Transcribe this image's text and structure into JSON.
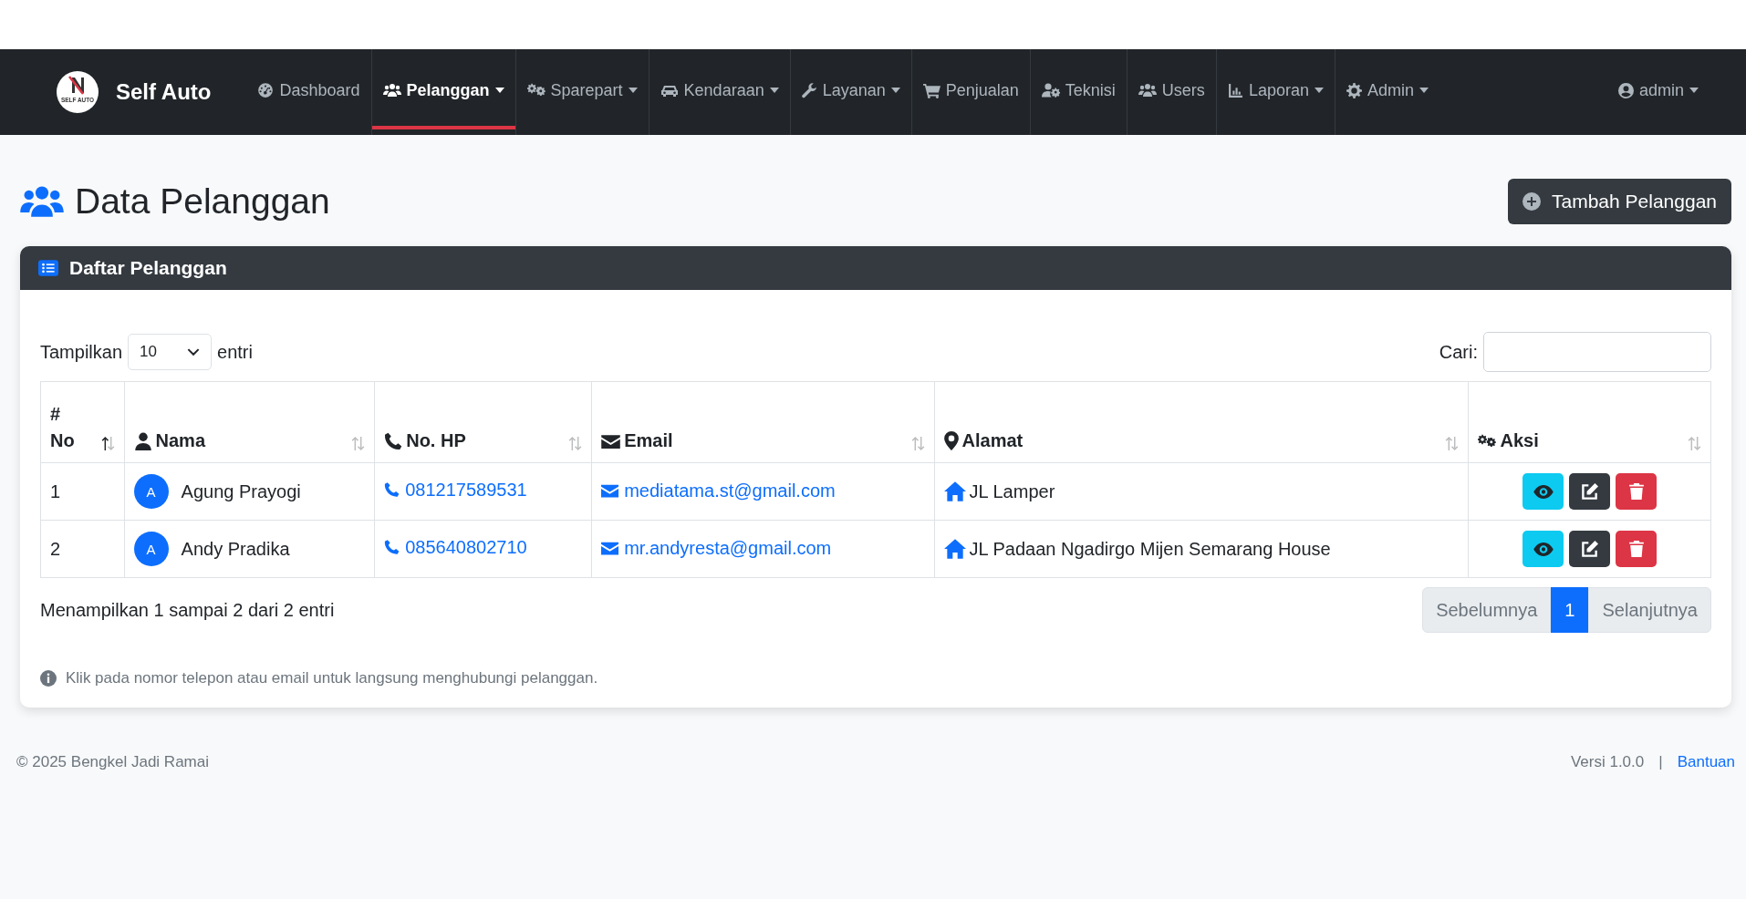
{
  "brand": {
    "name": "Self Auto",
    "logo_text": "SELF AUTO"
  },
  "nav": [
    {
      "label": "Dashboard",
      "dropdown": false,
      "selected": false
    },
    {
      "label": "Pelanggan",
      "dropdown": true,
      "selected": true
    },
    {
      "label": "Sparepart",
      "dropdown": true,
      "selected": false
    },
    {
      "label": "Kendaraan",
      "dropdown": true,
      "selected": false
    },
    {
      "label": "Layanan",
      "dropdown": true,
      "selected": false
    },
    {
      "label": "Penjualan",
      "dropdown": false,
      "selected": false
    },
    {
      "label": "Teknisi",
      "dropdown": false,
      "selected": false
    },
    {
      "label": "Users",
      "dropdown": false,
      "selected": false
    },
    {
      "label": "Laporan",
      "dropdown": true,
      "selected": false
    },
    {
      "label": "Admin",
      "dropdown": true,
      "selected": false
    }
  ],
  "user_menu": {
    "label": "admin",
    "dropdown": true
  },
  "page": {
    "title": "Data Pelanggan",
    "add_button": "Tambah Pelanggan"
  },
  "card": {
    "title": "Daftar Pelanggan",
    "length": {
      "label_before": "Tampilkan",
      "value": "10",
      "label_after": "entri"
    },
    "search": {
      "label": "Cari:"
    },
    "columns": [
      {
        "symbol": "#",
        "label": "No",
        "sorted": true
      },
      {
        "label": "Nama",
        "sorted": false
      },
      {
        "label": "No. HP",
        "sorted": false
      },
      {
        "label": "Email",
        "sorted": false
      },
      {
        "label": "Alamat",
        "sorted": false
      },
      {
        "label": "Aksi",
        "sorted": false
      }
    ],
    "rows": [
      {
        "no": "1",
        "avatar": "A",
        "name": "Agung Prayogi",
        "phone": "081217589531",
        "email": "mediatama.st@gmail.com",
        "address": "JL Lamper"
      },
      {
        "no": "2",
        "avatar": "A",
        "name": "Andy Pradika",
        "phone": "085640802710",
        "email": "mr.andyresta@gmail.com",
        "address": "JL Padaan Ngadirgo Mijen Semarang House"
      }
    ],
    "summary": "Menampilkan 1 sampai 2 dari 2 entri",
    "pagination": {
      "previous": "Sebelumnya",
      "pages": [
        {
          "label": "1",
          "selected": true
        }
      ],
      "next": "Selanjutnya"
    },
    "info": "Klik pada nomor telepon atau email untuk langsung menghubungi pelanggan."
  },
  "footer": {
    "copyright": "© 2025 Bengkel Jadi Ramai",
    "version": "Versi 1.0.0",
    "separator": "|",
    "help_link": "Bantuan"
  }
}
